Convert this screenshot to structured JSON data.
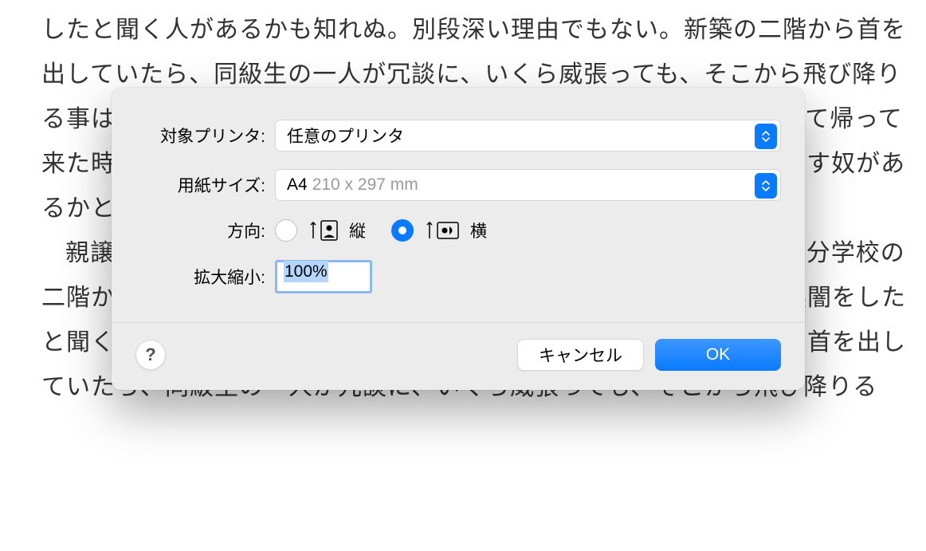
{
  "background": {
    "paragraph1": "したと聞く人があるかも知れぬ。別段深い理由でもない。新築の二階から首を出していたら、同級生の一人が冗談に、いくら威張っても、そこから飛び降りる事は出来まい。弱虫やーい。と囃したからである。小使に負ぶさって帰って来た時、おやじが大きな眼をして二階ぐらいから飛び降りて腰を抜かす奴があるかと云ったから、この次は抜かさずに飛んで見せますと答えた。",
    "paragraph2": "親譲りの無鉄砲で小供の時から損ばかりしている。小学校に居る時分学校の二階から飛び降りて一週間ほど腰を抜かした事がある。なぜそんな無闇をしたと聞く人があるかも知れぬ。別段深い理由でもない。新築の二階から首を出していたら、同級生の一人が冗談に、いくら威張っても、そこから飛び降りる"
  },
  "dialog": {
    "printer": {
      "label": "対象プリンタ:",
      "value": "任意のプリンタ"
    },
    "paper": {
      "label": "用紙サイズ:",
      "value": "A4",
      "dimensions": "210 x 297 mm"
    },
    "orientation": {
      "label": "方向:",
      "portrait": "縦",
      "landscape": "横",
      "selected": "landscape"
    },
    "scale": {
      "label": "拡大縮小:",
      "value": "100%"
    },
    "buttons": {
      "help": "?",
      "cancel": "キャンセル",
      "ok": "OK"
    }
  }
}
